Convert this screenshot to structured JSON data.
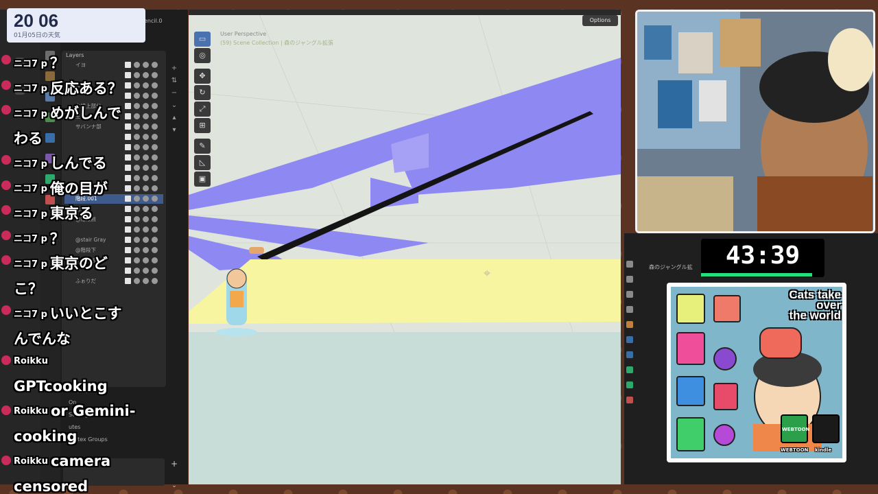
{
  "clock": {
    "time": "20 06",
    "date": "01月05日の天気"
  },
  "left_panel": {
    "pencil_tab": "encil.0",
    "layers_header": "Layers",
    "layers": [
      {
        "name": "イヨ",
        "active": false
      },
      {
        "name": "",
        "active": false
      },
      {
        "name": "@動物",
        "active": false
      },
      {
        "name": "",
        "active": false
      },
      {
        "name": "主線上部分",
        "active": false
      },
      {
        "name": "主線ベース",
        "active": false
      },
      {
        "name": "サバンナ部",
        "active": false
      },
      {
        "name": "",
        "active": false
      },
      {
        "name": "",
        "active": false
      },
      {
        "name": "",
        "active": false
      },
      {
        "name": "",
        "active": false
      },
      {
        "name": "",
        "active": false
      },
      {
        "name": "",
        "active": false
      },
      {
        "name": "階段.001",
        "active": true
      },
      {
        "name": "階段",
        "active": false
      },
      {
        "name": "@階段前",
        "active": false
      },
      {
        "name": "",
        "active": false
      },
      {
        "name": "@stair Gray",
        "active": false
      },
      {
        "name": "@階段下",
        "active": false
      },
      {
        "name": "@階段 壁",
        "active": false
      },
      {
        "name": "",
        "active": false
      },
      {
        "name": "ふぉりだ",
        "active": false
      }
    ],
    "sections": [
      "Display",
      "On",
      "Settings",
      "utes",
      "Vertex Groups"
    ]
  },
  "comments": [
    {
      "who": "ニコ7 p",
      "msg": "？"
    },
    {
      "who": "ニコ7 p",
      "msg": "反応ある？"
    },
    {
      "who": "ニコ7 p",
      "msg": "めがしんで"
    },
    {
      "who": "",
      "msg": "わる"
    },
    {
      "who": "ニコ7 p",
      "msg": "しんでる"
    },
    {
      "who": "ニコ7 p",
      "msg": "俺の目が"
    },
    {
      "who": "ニコ7 p",
      "msg": "東京る"
    },
    {
      "who": "ニコ7 p",
      "msg": "？"
    },
    {
      "who": "ニコ7 p",
      "msg": "東京のど"
    },
    {
      "who": "",
      "msg": "こ？"
    },
    {
      "who": "ニコ7 p",
      "msg": "いいとこす"
    },
    {
      "who": "",
      "msg": "んでんな"
    },
    {
      "who": "Roikku",
      "msg": ""
    },
    {
      "who": "",
      "msg": "GPTcooking"
    },
    {
      "who": "Roikku",
      "msg": "or Gemini-"
    },
    {
      "who": "",
      "msg": "cooking"
    },
    {
      "who": "Roikku",
      "msg": "camera"
    },
    {
      "who": "",
      "msg": "censored"
    }
  ],
  "viewport": {
    "perspective": "User Perspective",
    "collection": "(59) Scene Collection | 森のジャングル拡張",
    "options": "Options",
    "tools": [
      "select-box",
      "cursor",
      "move",
      "rotate",
      "scale",
      "transform",
      "annotate",
      "measure",
      "add-cube"
    ]
  },
  "timer": {
    "text": "43:39",
    "progress": 0.9
  },
  "right_blender": {
    "title": "森のジャングル拡"
  },
  "ad": {
    "title_lines": [
      "Cats take",
      "over",
      "the world"
    ],
    "webtoon": "WEBTOON",
    "kindle": "kindle"
  },
  "colors": {
    "stairs": "#8e88f2",
    "floor": "#f7f5a0",
    "active_layer": "#3e5b8c",
    "timer_bar": "#23e07a"
  }
}
